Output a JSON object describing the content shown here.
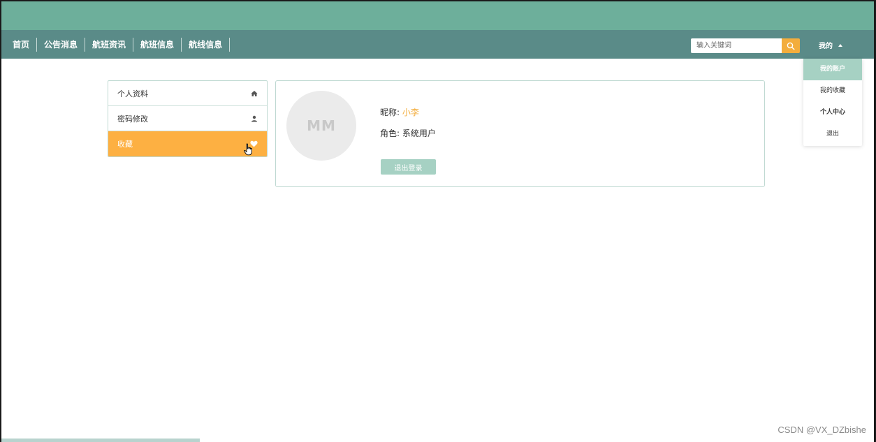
{
  "nav": {
    "links": [
      "首页",
      "公告消息",
      "航班资讯",
      "航班信息",
      "航线信息"
    ]
  },
  "search": {
    "placeholder": "输入关键词"
  },
  "user_menu": {
    "label": "我的",
    "items": [
      "我的账户",
      "我的收藏",
      "个人中心",
      "退出"
    ]
  },
  "side_menu": {
    "items": [
      {
        "label": "个人资料",
        "icon": "home-icon"
      },
      {
        "label": "密码修改",
        "icon": "user-icon"
      },
      {
        "label": "收藏",
        "icon": "heart-icon"
      }
    ]
  },
  "profile": {
    "avatar_text": "MM",
    "nickname_label": "昵称: ",
    "nickname": "小李",
    "role_label": "角色: ",
    "role": "系统用户",
    "logout_label": "退出登录"
  },
  "watermark": "CSDN @VX_DZbishe",
  "colors": {
    "topband": "#6daf9b",
    "navbar": "#5a8b88",
    "accent_orange": "#fdb042",
    "accent_green": "#a6d1c3"
  }
}
